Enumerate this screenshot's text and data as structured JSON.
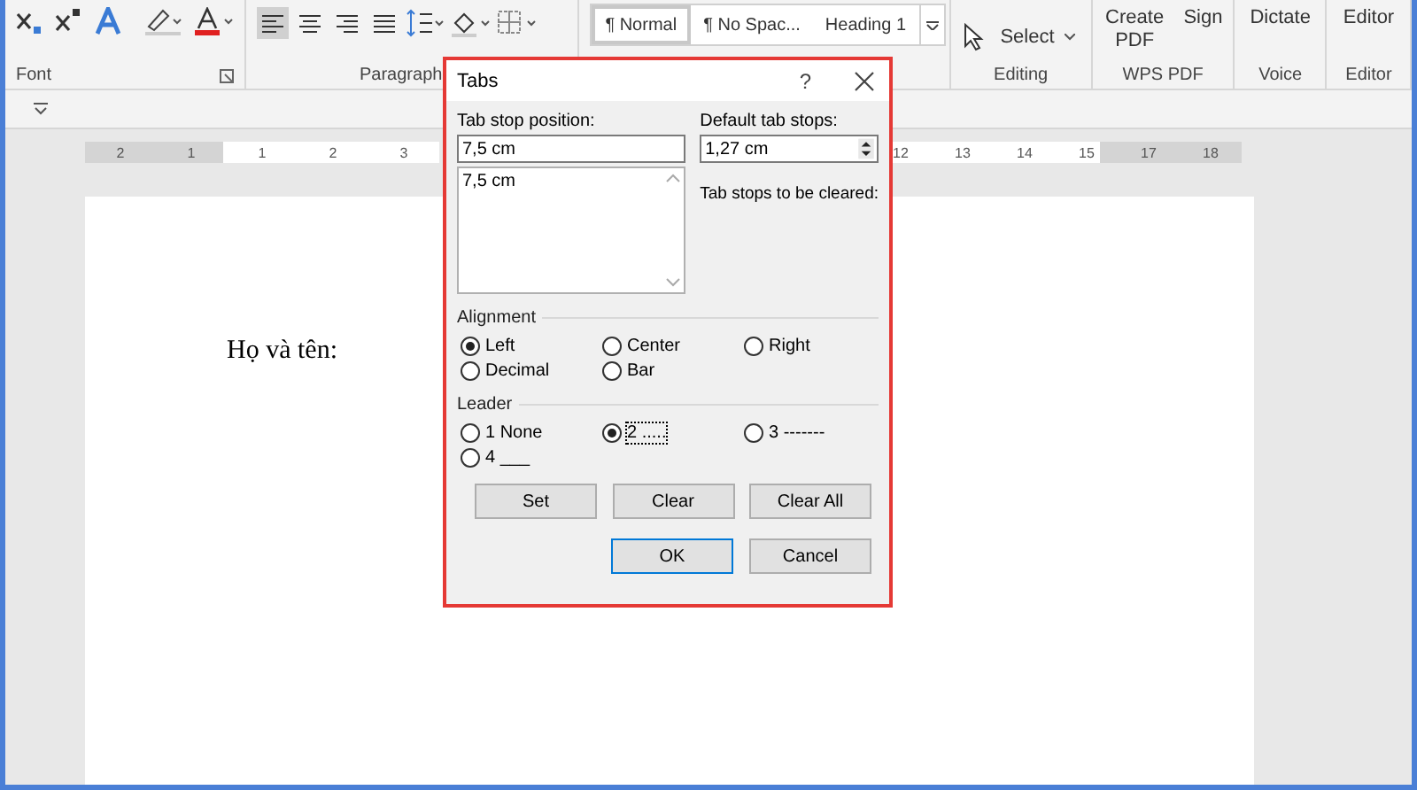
{
  "ribbon": {
    "font_group": {
      "label": "Font"
    },
    "paragraph_group": {
      "label": "Paragraph",
      "align_buttons": [
        {
          "kind": "left",
          "selected": true
        },
        {
          "kind": "center",
          "selected": false
        },
        {
          "kind": "right",
          "selected": false
        },
        {
          "kind": "justify",
          "selected": false
        }
      ]
    },
    "styles": [
      {
        "label": "¶ Normal",
        "selected": true
      },
      {
        "label": "¶ No Spac...",
        "selected": false
      },
      {
        "label": "Heading 1",
        "selected": false
      }
    ],
    "editing": {
      "select": "Select",
      "label": "Editing"
    },
    "wps_pdf": {
      "buttons": [
        "Create PDF",
        "Sign"
      ],
      "label": "WPS PDF"
    },
    "voice": {
      "button": "Dictate",
      "label": "Voice"
    },
    "editor": {
      "button": "Editor",
      "label": "Editor"
    }
  },
  "ruler": {
    "left_labels": [
      "2",
      "1",
      "1",
      "2",
      "3"
    ],
    "right_labels": [
      "12",
      "13",
      "14",
      "15",
      "17",
      "18"
    ]
  },
  "document": {
    "text": "Họ và tên:"
  },
  "dialog": {
    "title": "Tabs",
    "help": "?",
    "tab_stop_position": {
      "label": "Tab stop position:",
      "value": "7,5 cm",
      "list": [
        "7,5 cm"
      ]
    },
    "default_tab_stops": {
      "label": "Default tab stops:",
      "value": "1,27 cm"
    },
    "clear_label": "Tab stops to be cleared:",
    "alignment": {
      "label": "Alignment",
      "options": [
        {
          "label": "Left",
          "selected": true
        },
        {
          "label": "Center",
          "selected": false
        },
        {
          "label": "Right",
          "selected": false
        },
        {
          "label": "Decimal",
          "selected": false
        },
        {
          "label": "Bar",
          "selected": false
        }
      ]
    },
    "leader": {
      "label": "Leader",
      "options": [
        {
          "label": "1 None",
          "selected": false
        },
        {
          "label": "2 .....",
          "selected": true
        },
        {
          "label": "3 -------",
          "selected": false
        },
        {
          "label": "4 ___",
          "selected": false
        }
      ]
    },
    "action_buttons": [
      "Set",
      "Clear",
      "Clear All"
    ],
    "buttons": [
      {
        "label": "OK",
        "default": true
      },
      {
        "label": "Cancel",
        "default": false
      }
    ]
  }
}
